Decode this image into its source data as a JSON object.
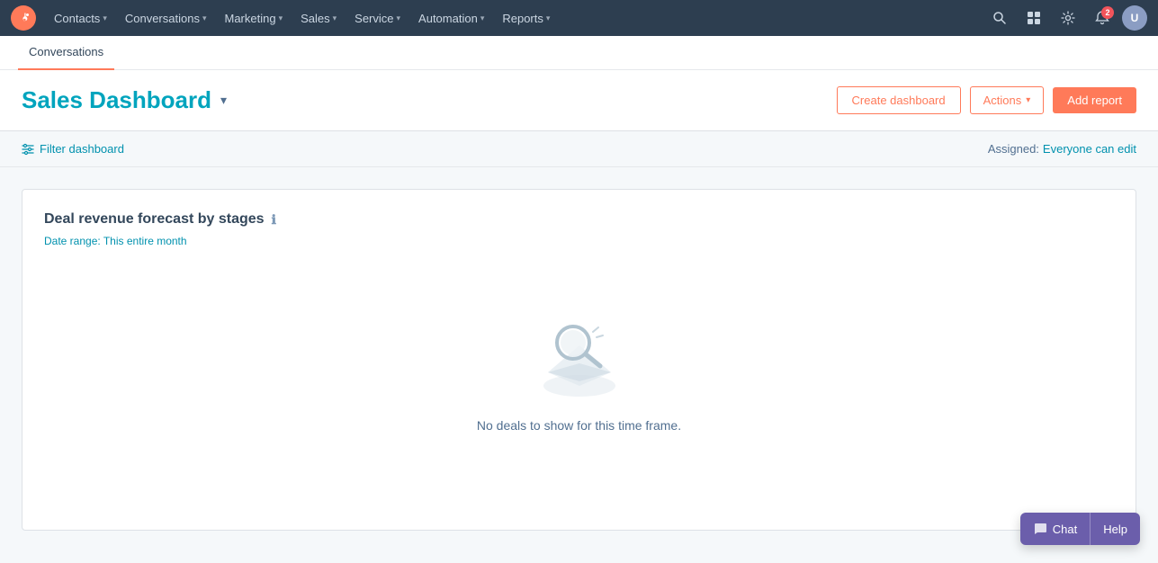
{
  "topnav": {
    "logo_alt": "HubSpot",
    "nav_items": [
      {
        "label": "Contacts",
        "has_dropdown": true
      },
      {
        "label": "Conversations",
        "has_dropdown": true
      },
      {
        "label": "Marketing",
        "has_dropdown": true
      },
      {
        "label": "Sales",
        "has_dropdown": true
      },
      {
        "label": "Service",
        "has_dropdown": true
      },
      {
        "label": "Automation",
        "has_dropdown": true
      },
      {
        "label": "Reports",
        "has_dropdown": true
      }
    ],
    "notification_count": "2",
    "avatar_initials": "U"
  },
  "breadcrumb": {
    "active_tab": "Conversations"
  },
  "page_header": {
    "title": "Sales Dashboard",
    "create_dashboard_label": "Create dashboard",
    "actions_label": "Actions",
    "add_report_label": "Add report"
  },
  "filter_bar": {
    "filter_label": "Filter dashboard",
    "assigned_label": "Assigned:",
    "assigned_value": "Everyone can edit"
  },
  "card": {
    "title": "Deal revenue forecast by stages",
    "date_range_prefix": "Date range:",
    "date_range_value": "This entire month",
    "empty_message": "No deals to show for this time frame."
  },
  "chat_widget": {
    "chat_label": "Chat",
    "help_label": "Help"
  },
  "colors": {
    "accent": "#ff7a59",
    "link": "#0091ae",
    "title": "#00a4bd",
    "nav_bg": "#2d3e50",
    "chat_bg": "#6b5eab"
  }
}
